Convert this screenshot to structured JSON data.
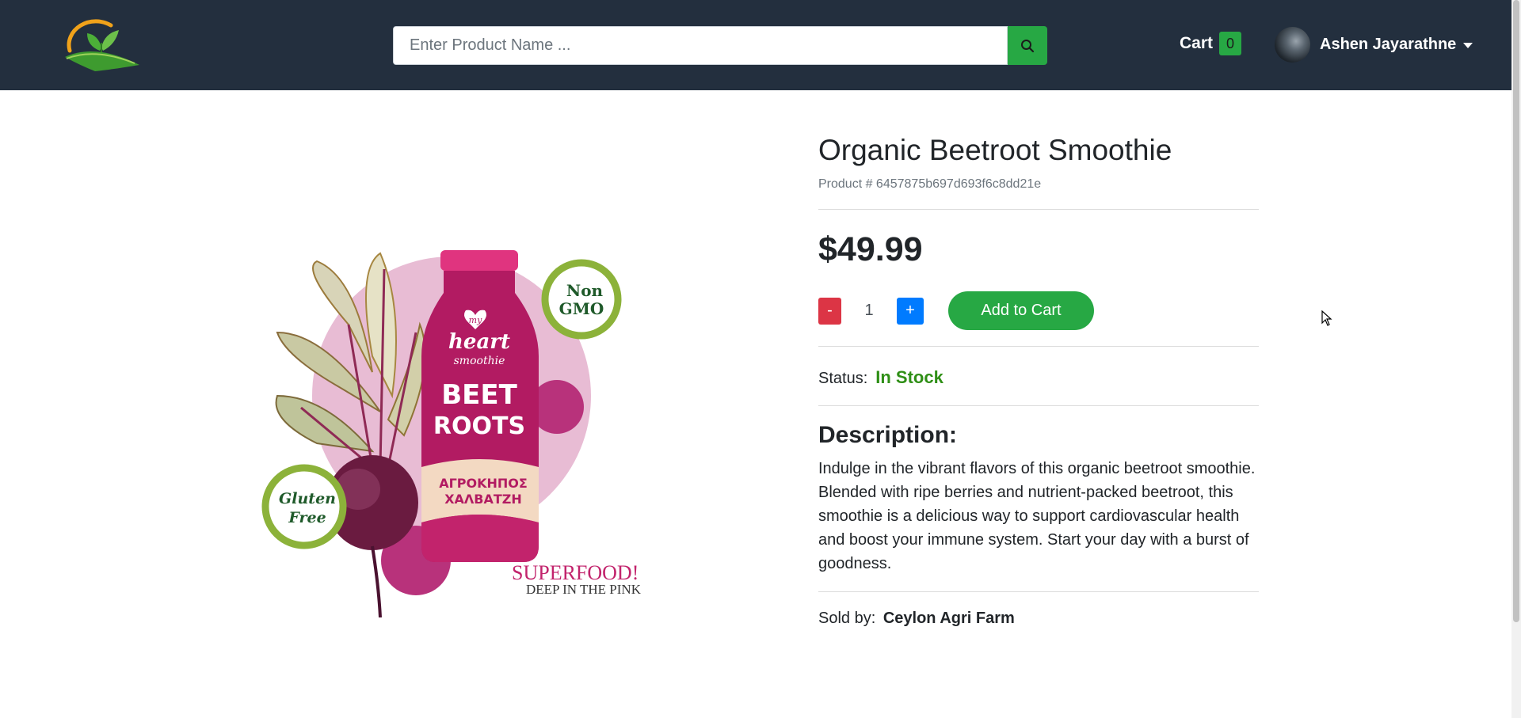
{
  "header": {
    "logo_icon": "leaf-sun-logo-icon",
    "search": {
      "placeholder": "Enter Product Name ...",
      "value": ""
    },
    "search_icon": "search-icon",
    "cart": {
      "label": "Cart",
      "count": "0"
    },
    "user": {
      "name": "Ashen Jayarathne",
      "caret_icon": "caret-down-icon"
    }
  },
  "product": {
    "title": "Organic Beetroot Smoothie",
    "id_label": "Product # 6457875b697d693f6c8dd21e",
    "price": "$49.99",
    "quantity": {
      "decrement_label": "-",
      "value": "1",
      "increment_label": "+"
    },
    "add_to_cart_label": "Add to Cart",
    "status_label": "Status:",
    "status_value": "In Stock",
    "description_heading": "Description:",
    "description": "Indulge in the vibrant flavors of this organic beetroot smoothie. Blended with ripe berries and nutrient-packed beetroot, this smoothie is a delicious way to support cardiovascular health and boost your immune system. Start your day with a burst of goodness.",
    "sold_by_label": "Sold by:",
    "seller": "Ceylon Agri Farm",
    "image": {
      "bottle_brand_1": "my",
      "bottle_brand_2": "heart",
      "bottle_brand_3": "smoothie",
      "bottle_name_1": "BEET",
      "bottle_name_2": "ROOTS",
      "bottle_maker_1": "ΑΓΡΟΚΗΠΟΣ",
      "bottle_maker_2": "ΧΑΛΒΑΤΖΗ",
      "badge_non_gmo_1": "Non",
      "badge_non_gmo_2": "GMO",
      "badge_gluten_1": "Gluten",
      "badge_gluten_2": "Free",
      "tagline_1": "SUPERFOOD!",
      "tagline_2": "DEEP IN THE PINK"
    }
  },
  "colors": {
    "navbar": "#232f3e",
    "success": "#27a844",
    "danger": "#dc3545",
    "primary": "#007bff",
    "in_stock": "#2f8f16"
  }
}
